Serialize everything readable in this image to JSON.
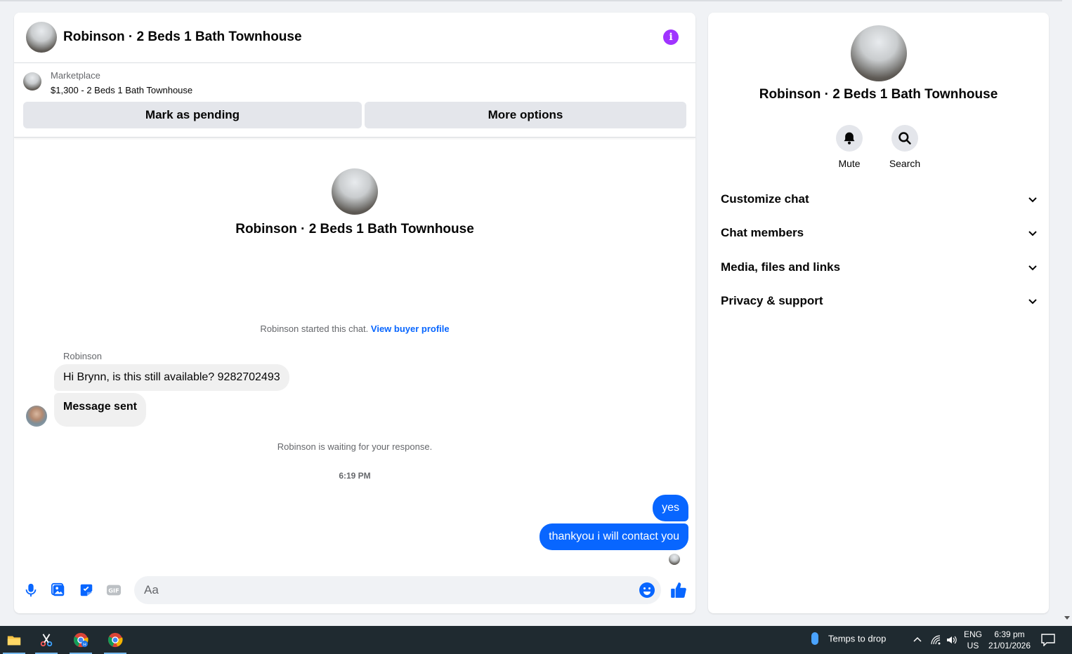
{
  "chat": {
    "title": "Robinson · 2 Beds 1 Bath Townhouse",
    "info_icon": "info-icon",
    "listing": {
      "source": "Marketplace",
      "price_title": "$1,300 - 2 Beds 1 Bath Townhouse",
      "mark_pending_label": "Mark as pending",
      "more_options_label": "More options"
    },
    "intro_title": "Robinson · 2 Beds 1 Bath Townhouse",
    "started_note": "Robinson started this chat.",
    "view_buyer_profile": "View buyer profile",
    "sender_name": "Robinson",
    "incoming": [
      "Hi Brynn, is this still available? 9282702493",
      "Message sent"
    ],
    "waiting_note": "Robinson is waiting for your response.",
    "timestamp": "6:19 PM",
    "outgoing": [
      "yes",
      "thankyou i will contact you"
    ],
    "composer": {
      "placeholder": "Aa",
      "icons": [
        "microphone-icon",
        "image-icon",
        "sticker-icon",
        "gif-icon",
        "emoji-icon",
        "thumbs-up-icon"
      ]
    }
  },
  "info_panel": {
    "title": "Robinson · 2 Beds 1 Bath Townhouse",
    "actions": [
      {
        "label": "Mute",
        "icon": "bell-icon"
      },
      {
        "label": "Search",
        "icon": "search-icon"
      }
    ],
    "sections": [
      "Customize chat",
      "Chat members",
      "Media, files and links",
      "Privacy & support"
    ]
  },
  "taskbar": {
    "weather": "Temps to drop",
    "language_top": "ENG",
    "language_bottom": "US",
    "time": "6:39 pm",
    "date": "21/01/2026"
  },
  "colors": {
    "accent_blue": "#0866ff",
    "info_purple": "#a033ff",
    "background": "#f0f2f5",
    "taskbar": "#1f2a30"
  }
}
